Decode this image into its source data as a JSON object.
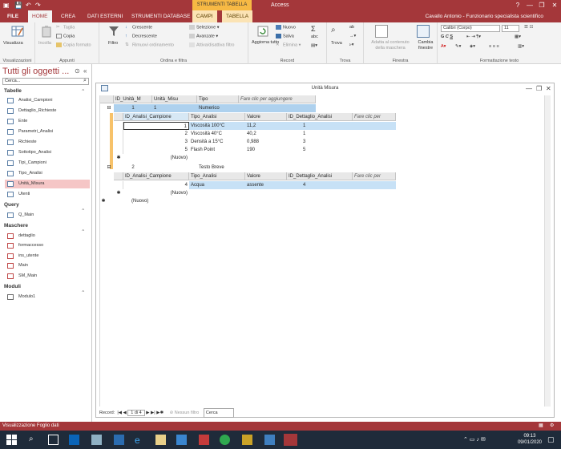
{
  "window": {
    "title": "Access",
    "context_title": "STRUMENTI TABELLA",
    "controls": [
      "?",
      "—",
      "❐",
      "✕"
    ]
  },
  "ribbon_tabs": [
    {
      "label": "FILE"
    },
    {
      "label": "HOME"
    },
    {
      "label": "CREA"
    },
    {
      "label": "DATI ESTERNI"
    },
    {
      "label": "STRUMENTI DATABASE"
    },
    {
      "label": "CAMPI"
    },
    {
      "label": "TABELLA"
    }
  ],
  "user": "Cavallo Antonio - Funzionario specialista scientifico",
  "ribbon": {
    "visualizza": {
      "button": "Visualizza",
      "group": "Visualizzazioni"
    },
    "appunti": {
      "incolla": "Incolla",
      "taglia": "Taglia",
      "copia": "Copia",
      "copia_formato": "Copia formato",
      "group": "Appunti"
    },
    "ordina": {
      "filtro": "Filtro",
      "crescente": "Crescente",
      "decrescente": "Decrescente",
      "rimuovi": "Rimuovi ordinamento",
      "selezione": "Selezione",
      "avanzate": "Avanzate",
      "attiva": "Attiva/disattiva filtro",
      "group": "Ordina e filtra"
    },
    "record": {
      "aggiorna": "Aggiorna tutto",
      "nuovo": "Nuovo",
      "salva": "Salva",
      "elimina": "Elimina",
      "group": "Record"
    },
    "trova": {
      "trova": "Trova",
      "group": "Trova"
    },
    "finestra": {
      "adatta": "Adatta al contenuto della maschera",
      "cambia": "Cambia finestre",
      "group": "Finestra"
    },
    "testo": {
      "font": "Calibri (Corpo)",
      "size": "11",
      "group": "Formattazione testo"
    }
  },
  "nav": {
    "title": "Tutti gli oggetti ...",
    "search_placeholder": "Cerca...",
    "sections": [
      {
        "label": "Tabelle",
        "items": [
          "Analisi_Campioni",
          "Dettaglio_Richieste",
          "Ente",
          "Parametri_Analisi",
          "Richieste",
          "Sottotipo_Analisi",
          "Tipi_Campioni",
          "Tipo_Analisi",
          "Unità_Misura",
          "Utenti"
        ]
      },
      {
        "label": "Query",
        "items": [
          "Q_Main"
        ]
      },
      {
        "label": "Maschere",
        "items": [
          "dettaglio",
          "formaccesso",
          "ins_utente",
          "Main",
          "SM_Main"
        ]
      },
      {
        "label": "Moduli",
        "items": [
          "Modulo1"
        ]
      }
    ],
    "selected": "Unità_Misura"
  },
  "doc": {
    "title": "Unità Misura",
    "main_headers": [
      "ID_Unità_M",
      "Unità_Misu",
      "Tipo",
      "Fare clic per aggiungere"
    ],
    "main_rows": [
      {
        "id": "1",
        "unita": "1",
        "tipo": "Numerico"
      },
      {
        "id": "2",
        "unita": "",
        "tipo": "Testo Breve"
      }
    ],
    "sub_headers": [
      "ID_Analisi_Campione",
      "Tipo_Analisi",
      "Valore",
      "ID_Dettaglio_Analisi",
      "Fare clic per"
    ],
    "sub1_rows": [
      {
        "id": "1",
        "tipo": "Viscosità 100°C",
        "valore": "11,2",
        "det": "1"
      },
      {
        "id": "2",
        "tipo": "Viscosità 40°C",
        "valore": "40,2",
        "det": "1"
      },
      {
        "id": "3",
        "tipo": "Densità a 15°C",
        "valore": "0,988",
        "det": "3"
      },
      {
        "id": "5",
        "tipo": "Flash Point",
        "valore": "190",
        "det": "5"
      }
    ],
    "sub2_rows": [
      {
        "id": "4",
        "tipo": "Acqua",
        "valore": "assente",
        "det": "4"
      }
    ],
    "new_label": "(Nuovo)"
  },
  "record_nav": {
    "label": "Record:",
    "position": "1 di 4",
    "filter": "Nessun filtro",
    "search": "Cerca"
  },
  "status": {
    "text": "Visualizzazione Foglio dati"
  },
  "clock": {
    "time": "09:13",
    "date": "09/01/2020"
  }
}
